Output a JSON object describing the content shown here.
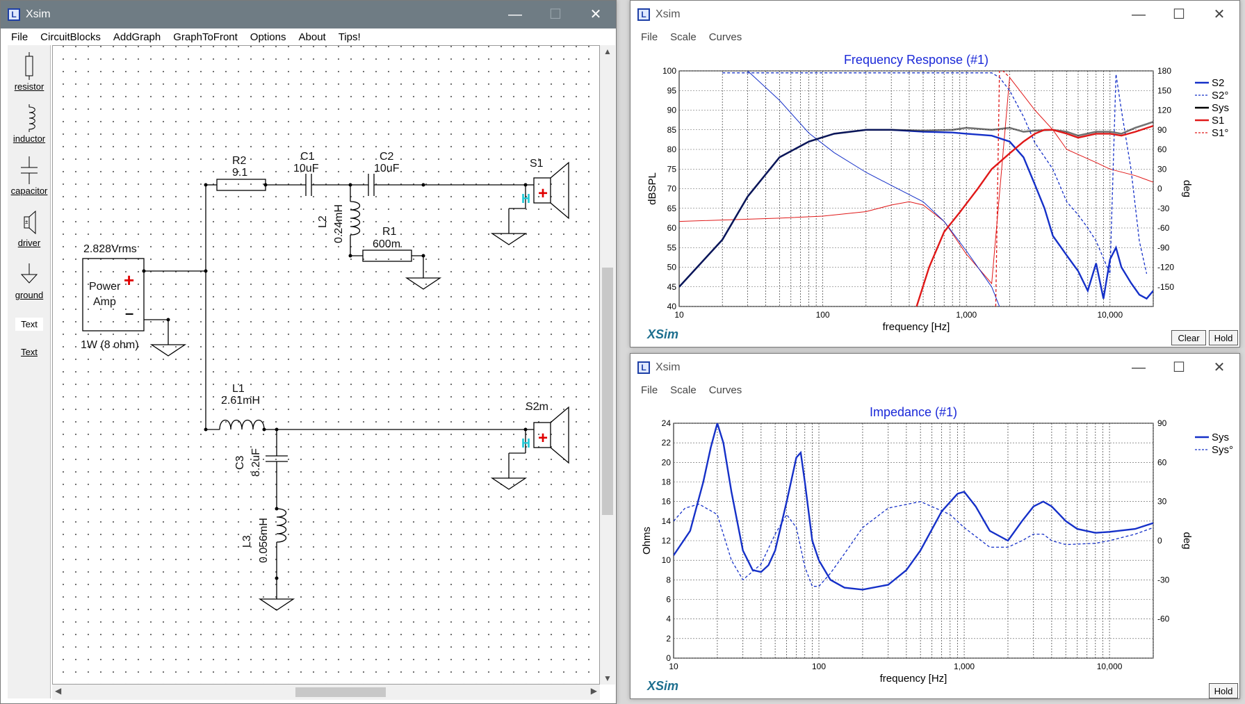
{
  "schematic_window": {
    "title": "Xsim",
    "icon_letter": "L",
    "menu": [
      "File",
      "CircuitBlocks",
      "AddGraph",
      "GraphToFront",
      "Options",
      "About",
      "Tips!"
    ],
    "toolbox": [
      {
        "label": "resistor",
        "icon": "resistor-icon"
      },
      {
        "label": "inductor",
        "icon": "inductor-icon"
      },
      {
        "label": "capacitor",
        "icon": "capacitor-icon"
      },
      {
        "label": "driver",
        "icon": "driver-icon"
      },
      {
        "label": "ground",
        "icon": "ground-icon"
      },
      {
        "label": "Text",
        "icon": "text-tool"
      },
      {
        "label": "Text",
        "icon": "text-tool"
      }
    ],
    "circuit": {
      "source_voltage": "2.828Vrms",
      "amp_line1": "Power",
      "amp_line2": "Amp",
      "amp_power": "1W (8 ohm)",
      "r2_name": "R2",
      "r2_value": "9.1",
      "c1_name": "C1",
      "c1_value": "10uF",
      "c2_name": "C2",
      "c2_value": "10uF",
      "l2_name": "L2",
      "l2_value": "0.24mH",
      "r1_name": "R1",
      "r1_value": "600m",
      "s1_name": "S1",
      "l1_name": "L1",
      "l1_value": "2.61mH",
      "c3_name": "C3",
      "c3_value": "8.2uF",
      "l3_name": "L3",
      "l3_value": "0.056mH",
      "s2_name": "S2m",
      "plus_sign": "+",
      "minus_sign": "–",
      "driver_marker": "H"
    }
  },
  "freq_window": {
    "title": "Xsim",
    "icon_letter": "L",
    "menu": [
      "File",
      "Scale",
      "Curves"
    ],
    "brand": "XSim",
    "buttons": [
      "Clear",
      "Hold"
    ],
    "chart_data": {
      "type": "line",
      "title": "Frequency Response (#1)",
      "xlabel": "frequency [Hz]",
      "ylabel": "dBSPL",
      "y2label": "deg",
      "xscale": "log",
      "xlim": [
        10,
        20000
      ],
      "ylim": [
        40,
        100
      ],
      "y2lim": [
        -180,
        180
      ],
      "grid": true,
      "legend_position": "right",
      "x_ticks": [
        "10",
        "100",
        "1,000",
        "10,000"
      ],
      "y_ticks": [
        40,
        45,
        50,
        55,
        60,
        65,
        70,
        75,
        80,
        85,
        90,
        95,
        100
      ],
      "y2_ticks": [
        -150,
        -120,
        -90,
        -60,
        -30,
        0,
        30,
        60,
        90,
        120,
        150,
        180
      ],
      "series": [
        {
          "name": "S2",
          "style": "solid",
          "color": "#1530c8",
          "axis": "left",
          "x": [
            10,
            20,
            30,
            50,
            80,
            120,
            200,
            300,
            500,
            800,
            1000,
            1500,
            2000,
            2500,
            3000,
            3500,
            4000,
            5000,
            6000,
            7000,
            8000,
            9000,
            10000,
            11000,
            12000,
            14000,
            16000,
            18000,
            20000
          ],
          "y": [
            45,
            57,
            68,
            78,
            82,
            84,
            85,
            85,
            84.5,
            84.3,
            84,
            83.5,
            82,
            78,
            71,
            65,
            58,
            53,
            49,
            44,
            51,
            42,
            52,
            55,
            50,
            46,
            43,
            42,
            44
          ]
        },
        {
          "name": "S2°",
          "style": "dashed",
          "color": "#1530c8",
          "axis": "right",
          "x": [
            20,
            25,
            30,
            35,
            40,
            60,
            100,
            200,
            400,
            700,
            1000,
            1500,
            1700,
            2000,
            2500,
            3000,
            4000,
            5000,
            6000,
            7000,
            8000,
            10000,
            11000,
            12000,
            14000,
            16000,
            18000
          ],
          "y": [
            177,
            177,
            177,
            177,
            177,
            177,
            177,
            177,
            177,
            177,
            177,
            177,
            170,
            150,
            110,
            70,
            30,
            -20,
            -40,
            -60,
            -80,
            -130,
            175,
            120,
            30,
            -80,
            -130
          ]
        },
        {
          "name": "Sys",
          "style": "solid",
          "color": "#000000",
          "axis": "left",
          "x": [
            10,
            20,
            30,
            50,
            80,
            120,
            200,
            300,
            500,
            800,
            1000,
            1500,
            2000,
            2500,
            3000,
            4000,
            5000,
            6000,
            8000,
            10000,
            12000,
            15000,
            20000
          ],
          "y": [
            45,
            57,
            68,
            78,
            82,
            84,
            85,
            85,
            84.8,
            85,
            85.5,
            85,
            85.5,
            84.5,
            84.8,
            85,
            84.5,
            83.5,
            84.5,
            84.5,
            84,
            85.5,
            87
          ]
        },
        {
          "name": "S1",
          "style": "solid",
          "color": "#e01818",
          "axis": "left",
          "x": [
            450,
            550,
            700,
            900,
            1200,
            1500,
            2000,
            2500,
            3000,
            3500,
            4000,
            5000,
            6000,
            8000,
            10000,
            12000,
            15000,
            20000
          ],
          "y": [
            40,
            50,
            59,
            64,
            70,
            75,
            79,
            82,
            84,
            85,
            85,
            84,
            83,
            84,
            84,
            83.5,
            84.5,
            86
          ]
        },
        {
          "name": "S1°",
          "style": "dashed",
          "color": "#e01818",
          "axis": "right",
          "x": [
            1600,
            1650,
            1700,
            1800,
            2000
          ],
          "y": [
            -180,
            0,
            180,
            180,
            170
          ]
        }
      ],
      "thin_overlays": [
        {
          "color": "#e01818",
          "axis": "right",
          "x": [
            10,
            50,
            100,
            200,
            300,
            400,
            500,
            700,
            1000,
            1500,
            2000,
            3000,
            4000,
            5000,
            8000,
            10000,
            15000,
            20000
          ],
          "y": [
            -50,
            -45,
            -42,
            -35,
            -25,
            -20,
            -25,
            -50,
            -100,
            -145,
            170,
            120,
            90,
            60,
            40,
            30,
            20,
            10
          ]
        },
        {
          "color": "#1530c8",
          "axis": "right",
          "x": [
            30,
            50,
            80,
            120,
            200,
            300,
            500,
            700,
            1000,
            1500,
            1700
          ],
          "y": [
            180,
            135,
            85,
            55,
            25,
            5,
            -20,
            -50,
            -95,
            -150,
            -180
          ]
        }
      ]
    }
  },
  "imp_window": {
    "title": "Xsim",
    "icon_letter": "L",
    "menu": [
      "File",
      "Scale",
      "Curves"
    ],
    "brand": "XSim",
    "buttons": [
      "Hold"
    ],
    "chart_data": {
      "type": "line",
      "title": "Impedance (#1)",
      "xlabel": "frequency [Hz]",
      "ylabel": "Ohms",
      "y2label": "deg",
      "xscale": "log",
      "xlim": [
        10,
        20000
      ],
      "ylim": [
        0,
        24
      ],
      "y2lim": [
        -90,
        90
      ],
      "grid": true,
      "legend_position": "right",
      "x_ticks": [
        "10",
        "100",
        "1,000",
        "10,000"
      ],
      "y_ticks": [
        0,
        2,
        4,
        6,
        8,
        10,
        12,
        14,
        16,
        18,
        20,
        22,
        24
      ],
      "y2_ticks": [
        -60,
        -30,
        0,
        30,
        60,
        90
      ],
      "series": [
        {
          "name": "Sys",
          "style": "solid",
          "color": "#1530c8",
          "axis": "left",
          "x": [
            10,
            13,
            16,
            18,
            20,
            22,
            25,
            30,
            35,
            40,
            45,
            50,
            60,
            70,
            75,
            80,
            90,
            100,
            120,
            150,
            200,
            300,
            400,
            500,
            700,
            900,
            1000,
            1200,
            1500,
            2000,
            2500,
            3000,
            3500,
            4000,
            5000,
            6000,
            8000,
            10000,
            15000,
            20000
          ],
          "y": [
            10.5,
            13,
            18,
            21.5,
            24,
            22,
            17,
            11,
            9,
            8.8,
            9.5,
            11,
            16,
            20.5,
            21,
            18,
            12,
            10,
            8,
            7.2,
            7,
            7.5,
            9,
            11,
            15,
            16.8,
            17,
            15.5,
            13,
            12,
            14,
            15.5,
            16,
            15.5,
            14,
            13.2,
            12.8,
            12.9,
            13.2,
            13.8
          ]
        },
        {
          "name": "Sys°",
          "style": "dashed",
          "color": "#1530c8",
          "axis": "right",
          "x": [
            10,
            12,
            15,
            20,
            25,
            30,
            40,
            50,
            60,
            70,
            80,
            90,
            100,
            120,
            150,
            200,
            300,
            500,
            800,
            1000,
            1500,
            2000,
            2500,
            3000,
            3500,
            4000,
            5000,
            8000,
            10000,
            15000,
            20000
          ],
          "y": [
            15,
            25,
            28,
            20,
            -15,
            -30,
            -18,
            5,
            20,
            10,
            -20,
            -35,
            -35,
            -25,
            -10,
            10,
            25,
            30,
            20,
            10,
            -5,
            -5,
            0,
            5,
            5,
            0,
            -3,
            -2,
            0,
            5,
            10
          ]
        }
      ]
    }
  }
}
